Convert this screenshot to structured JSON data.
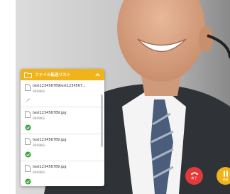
{
  "panel": {
    "title": "ファイル転送リスト",
    "items": [
      {
        "name": "test123456789test1234567...",
        "size": "9999KB",
        "status": "transferring"
      },
      {
        "name": "test123456789.jpg",
        "size": "9999KB",
        "status": "done"
      },
      {
        "name": "test123456789.jpg",
        "size": "9999KB",
        "status": "done"
      },
      {
        "name": "test123456789.jpg",
        "size": "9999KB",
        "status": "done"
      }
    ]
  },
  "call": {
    "end_label": "終了",
    "hold_label": "保留"
  },
  "colors": {
    "accent": "#f0b31a",
    "end": "#e03a3a",
    "success": "#3aa53a"
  },
  "icons": {
    "panel": "folder-icon",
    "collapse": "chevron-up-icon",
    "file": "document-icon",
    "transferring": "spinner-icon",
    "done": "check-circle-icon",
    "end": "phone-hangup-icon",
    "hold": "pause-icon"
  }
}
